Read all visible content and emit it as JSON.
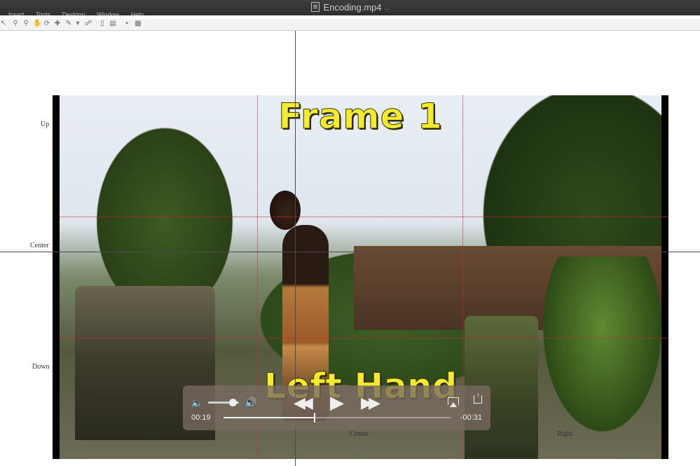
{
  "window": {
    "title": "Encoding.mp4",
    "menu": [
      "Insert",
      "Tools",
      "Desktop",
      "Window",
      "Help"
    ]
  },
  "toolbar": {
    "icons": [
      "pointer-icon",
      "zoom-in-icon",
      "zoom-out-icon",
      "pan-icon",
      "rotate-icon",
      "data-cursor-icon",
      "brush-icon",
      "link-icon",
      "print-icon",
      "colorbar-icon",
      "legend-icon",
      "hide-tools-icon",
      "dock-icon"
    ]
  },
  "figure": {
    "y_labels": [
      "Up",
      "Center",
      "Down"
    ],
    "x_labels": [
      "Left",
      "Center",
      "Right"
    ]
  },
  "video": {
    "overlay_top": "Frame 1",
    "overlay_bottom": "Left Hand",
    "grid_color": "#e0202a",
    "text_color": "#f4ea2e"
  },
  "player": {
    "current_time": "00:19",
    "remaining_time": "-00:31",
    "progress": 0.4,
    "volume": 0.8
  }
}
